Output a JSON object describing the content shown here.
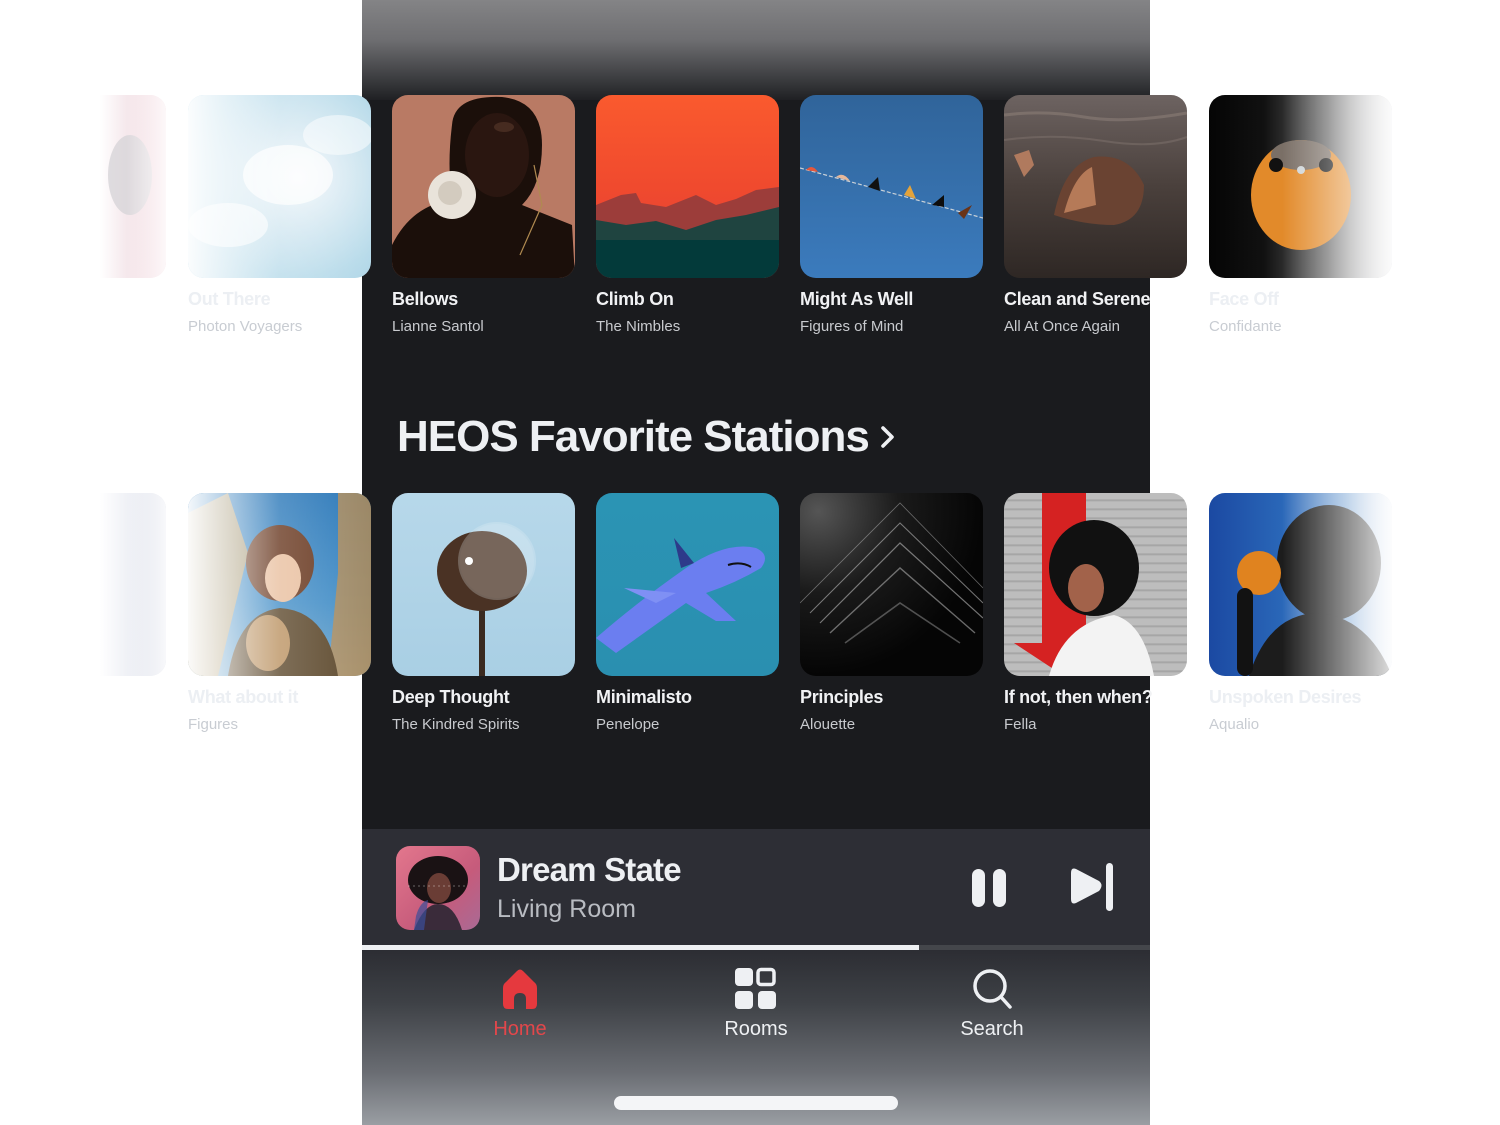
{
  "colors": {
    "background": "#1a1b1e",
    "player_bg": "#2d2e35",
    "accent": "#e2474b",
    "text_primary": "#eef0f3",
    "text_secondary": "#c8cace"
  },
  "row1": {
    "items": [
      {
        "title": "",
        "artist": "",
        "art": "pink-blurred-portrait",
        "visibility": "ghost"
      },
      {
        "title": "Out There",
        "artist": "Photon Voyagers",
        "art": "clouds",
        "visibility": "faded"
      },
      {
        "title": "Bellows",
        "artist": "Lianne Santol",
        "art": "portrait-with-flower",
        "visibility": "visible"
      },
      {
        "title": "Climb On",
        "artist": "The Nimbles",
        "art": "sunset-mountains",
        "visibility": "visible"
      },
      {
        "title": "Might As Well",
        "artist": "Figures of Mind",
        "art": "birds-on-wire",
        "visibility": "visible"
      },
      {
        "title": "Clean and Serene",
        "artist": "All At Once Again",
        "art": "woman-in-water",
        "visibility": "visible"
      },
      {
        "title": "Face Off",
        "artist": "Confidante",
        "art": "orange-bird",
        "visibility": "faded"
      }
    ]
  },
  "section": {
    "title": "HEOS Favorite Stations",
    "chevron_icon": "chevron-right-icon"
  },
  "row2": {
    "items": [
      {
        "title": "",
        "artist": "",
        "art": "pale-gradient",
        "visibility": "ghost"
      },
      {
        "title": "What about it",
        "artist": "Figures",
        "art": "woman-in-reeds",
        "visibility": "faded"
      },
      {
        "title": "Deep Thought",
        "artist": "The Kindred Spirits",
        "art": "palm-tree-bubble",
        "visibility": "visible"
      },
      {
        "title": "Minimalisto",
        "artist": "Penelope",
        "art": "shark",
        "visibility": "visible"
      },
      {
        "title": "Principles",
        "artist": "Alouette",
        "art": "dark-chevrons",
        "visibility": "visible"
      },
      {
        "title": "If not, then when?",
        "artist": "Fella",
        "art": "woman-red-arrow",
        "visibility": "visible"
      },
      {
        "title": "Unspoken Desires",
        "artist": "Aqualio",
        "art": "man-with-orange",
        "visibility": "faded"
      }
    ]
  },
  "now_playing": {
    "title": "Dream State",
    "room": "Living Room",
    "art": "dream-state-cover",
    "state": "playing",
    "progress": 0.707,
    "pause_icon": "pause-icon",
    "next_icon": "skip-next-icon"
  },
  "tabs": [
    {
      "label": "Home",
      "icon": "home-icon",
      "active": true
    },
    {
      "label": "Rooms",
      "icon": "rooms-grid-icon",
      "active": false
    },
    {
      "label": "Search",
      "icon": "search-icon",
      "active": false
    }
  ]
}
